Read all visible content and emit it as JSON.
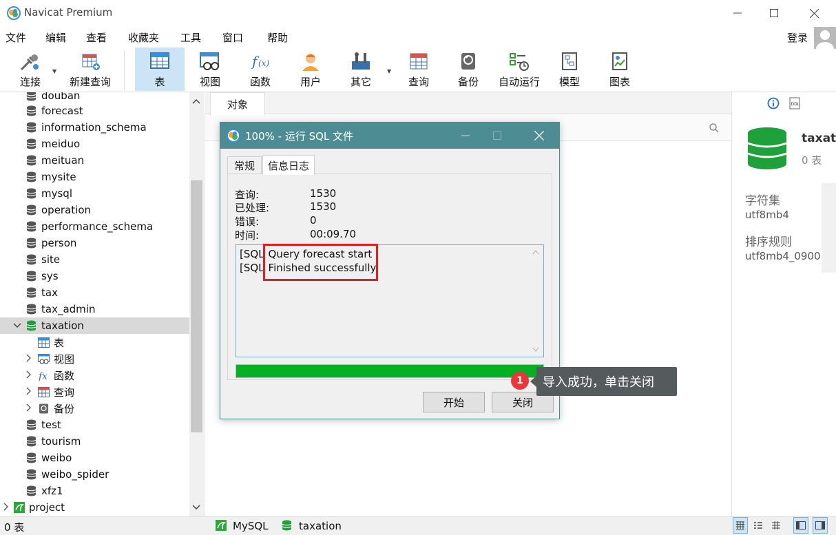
{
  "window": {
    "title": "Navicat Premium"
  },
  "menu": [
    "文件",
    "编辑",
    "查看",
    "收藏夹",
    "工具",
    "窗口",
    "帮助"
  ],
  "user": {
    "login_label": "登录"
  },
  "toolbar": {
    "connect": "连接",
    "new_query": "新建查询",
    "table": "表",
    "view": "视图",
    "function": "函数",
    "user": "用户",
    "other": "其它",
    "query": "查询",
    "backup": "备份",
    "automation": "自动运行",
    "model": "模型",
    "chart": "图表"
  },
  "tree": {
    "top_cut": "douban",
    "dbs_before": [
      "forecast",
      "information_schema",
      "meiduo",
      "meituan",
      "mysite",
      "mysql",
      "operation",
      "performance_schema",
      "person",
      "site",
      "sys",
      "tax",
      "tax_admin"
    ],
    "selected_db": "taxation",
    "children": [
      "表",
      "视图",
      "函数",
      "查询",
      "备份"
    ],
    "dbs_after": [
      "test",
      "tourism",
      "weibo",
      "weibo_spider",
      "xfz1"
    ],
    "connection": "project"
  },
  "center": {
    "tab_objects": "对象"
  },
  "right_panel": {
    "db_name": "taxat",
    "table_count": "0 表",
    "charset_label": "字符集",
    "charset_value": "utf8mb4",
    "collation_label": "排序规则",
    "collation_value": "utf8mb4_0900"
  },
  "statusbar": {
    "count": "0 表",
    "connection": "MySQL",
    "database": "taxation"
  },
  "dialog": {
    "title": "100% - 运行 SQL 文件",
    "tabs": [
      "常规",
      "信息日志"
    ],
    "active_tab": "信息日志",
    "stats": [
      {
        "label": "查询:",
        "value": "1530"
      },
      {
        "label": "已处理:",
        "value": "1530"
      },
      {
        "label": "错误:",
        "value": "0"
      },
      {
        "label": "时间:",
        "value": "00:09.70"
      }
    ],
    "log": [
      {
        "prefix": "[SQL",
        "text": "Query forecast start"
      },
      {
        "prefix": "[SQL",
        "text": "Finished successfully"
      }
    ],
    "progress_percent": 100,
    "start_button": "开始",
    "close_button": "关闭"
  },
  "tooltip": {
    "badge": "1",
    "text": "导入成功，单击关闭"
  },
  "colors": {
    "dialog_title": "#4e8c94",
    "progress": "#06b025",
    "highlight": "#e02020",
    "db_green": "#1ea03a"
  }
}
